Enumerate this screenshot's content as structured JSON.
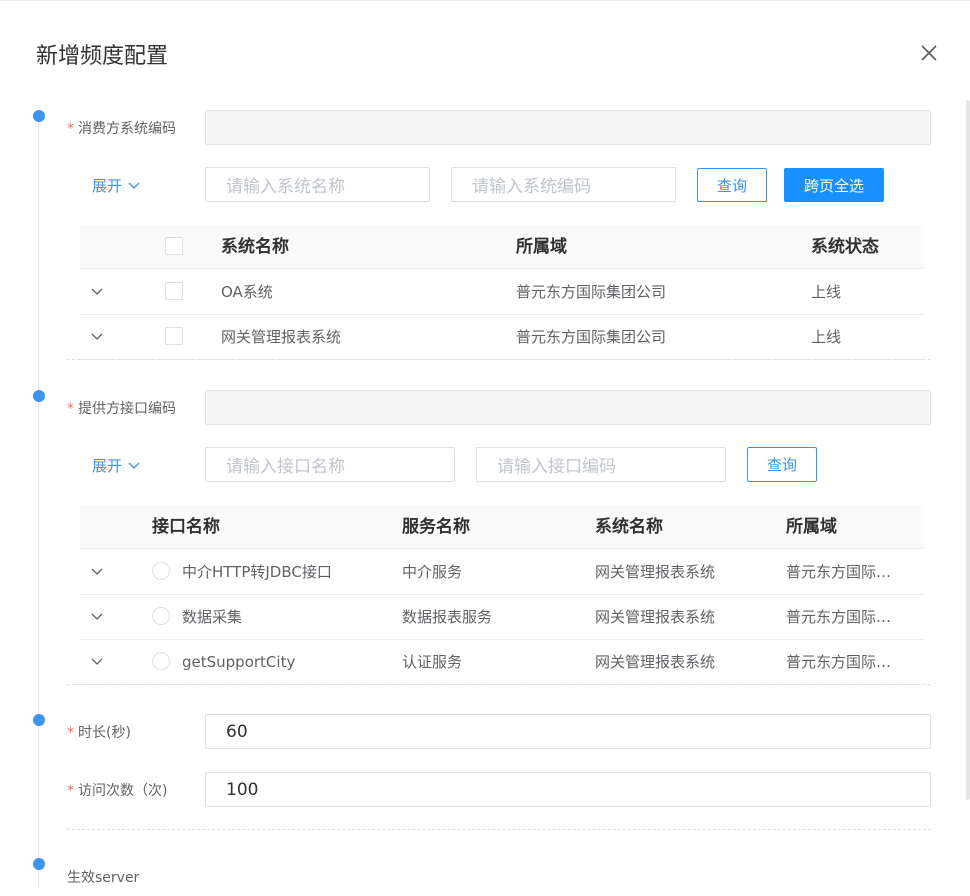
{
  "dialog": {
    "title": "新增频度配置"
  },
  "icons": {
    "close": "close-icon",
    "chevron": "chevron-down-icon"
  },
  "colors": {
    "primary": "#1890ff",
    "link": "#3c93f1",
    "required": "#f56c6c",
    "timeline": "#3c93f1"
  },
  "consumer": {
    "label": "消费方系统编码",
    "value": "",
    "expand_label": "展开",
    "name_placeholder": "请输入系统名称",
    "code_placeholder": "请输入系统编码",
    "query_label": "查询",
    "select_all_label": "跨页全选",
    "table": {
      "headers": [
        "系统名称",
        "所属域",
        "系统状态"
      ],
      "rows": [
        {
          "name": "OA系统",
          "domain": "普元东方国际集团公司",
          "status": "上线"
        },
        {
          "name": "网关管理报表系统",
          "domain": "普元东方国际集团公司",
          "status": "上线"
        }
      ]
    }
  },
  "provider": {
    "label": "提供方接口编码",
    "value": "",
    "expand_label": "展开",
    "name_placeholder": "请输入接口名称",
    "code_placeholder": "请输入接口编码",
    "query_label": "查询",
    "table": {
      "headers": [
        "接口名称",
        "服务名称",
        "系统名称",
        "所属域"
      ],
      "rows": [
        {
          "name": "中介HTTP转JDBC接口",
          "service": "中介服务",
          "system": "网关管理报表系统",
          "domain": "普元东方国际…"
        },
        {
          "name": "数据采集",
          "service": "数据报表服务",
          "system": "网关管理报表系统",
          "domain": "普元东方国际…"
        },
        {
          "name": "getSupportCity",
          "service": "认证服务",
          "system": "网关管理报表系统",
          "domain": "普元东方国际…"
        }
      ]
    }
  },
  "duration": {
    "label": "时长(秒)",
    "value": "60"
  },
  "visits": {
    "label": "访问次数（次)",
    "value": "100"
  },
  "server": {
    "label": "生效server"
  }
}
